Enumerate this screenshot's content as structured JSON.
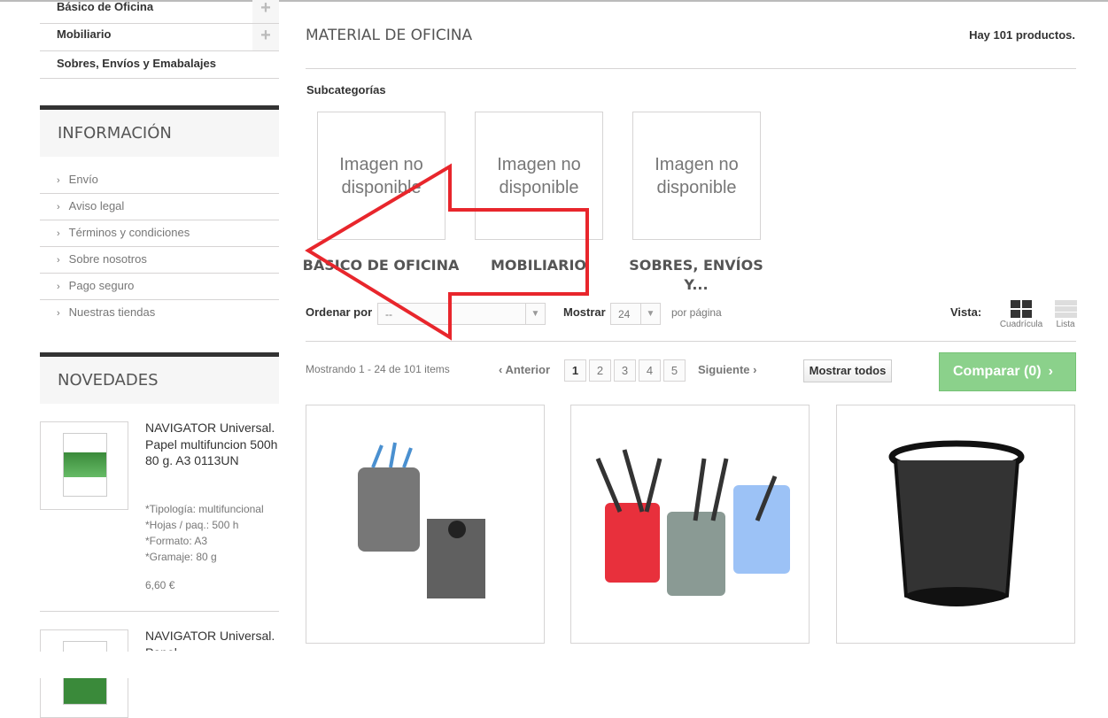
{
  "sidebar": {
    "categories": [
      {
        "label": "Básico de Oficina",
        "expandable": true
      },
      {
        "label": "Mobiliario",
        "expandable": true
      },
      {
        "label": "Sobres, Envíos y Emabalajes",
        "expandable": false
      }
    ],
    "info_title": "INFORMACIÓN",
    "info_links": [
      "Envío",
      "Aviso legal",
      "Términos y condiciones",
      "Sobre nosotros",
      "Pago seguro",
      "Nuestras tiendas"
    ],
    "news_title": "NOVEDADES",
    "news": [
      {
        "name": "NAVIGATOR Universal. Papel multifuncion 500h 80 g. A3 0113UN",
        "features": [
          "*Tipología: multifuncional",
          "*Hojas / paq.: 500 h",
          "*Formato: A3",
          "*Gramaje: 80 g"
        ],
        "price": "6,60 €"
      },
      {
        "name": "NAVIGATOR Universal. Papel"
      }
    ]
  },
  "main": {
    "title": "MATERIAL DE OFICINA",
    "count": "Hay 101 productos.",
    "subcat_heading": "Subcategorías",
    "no_image": "Imagen no disponible",
    "subcategories": [
      "BÁSICO DE OFICINA",
      "MOBILIARIO",
      "SOBRES, ENVÍOS Y..."
    ],
    "sort_label": "Ordenar por",
    "sort_value": "--",
    "show_label": "Mostrar",
    "show_value": "24",
    "per_page": "por página",
    "view_label": "Vista:",
    "view_grid": "Cuadrícula",
    "view_list": "Lista",
    "showing": "Mostrando 1 - 24 de 101 items",
    "prev": "Anterior",
    "next": "Siguiente",
    "pages": [
      "1",
      "2",
      "3",
      "4",
      "5"
    ],
    "current_page": "1",
    "show_all": "Mostrar todos",
    "compare": "Comparar (0)",
    "accent": "#8bd18b",
    "arrow_color": "#e8262c"
  }
}
